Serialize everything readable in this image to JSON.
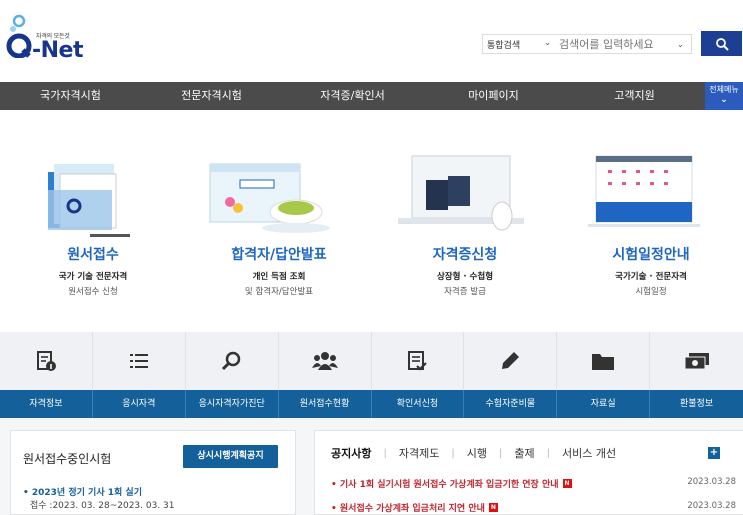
{
  "logo": {
    "small": "자격의 모든것",
    "main": "-Net"
  },
  "search": {
    "category": "통합검색",
    "placeholder": "검색어를 입력하세요"
  },
  "gnb": {
    "items": [
      "국가자격시험",
      "전문자격시험",
      "자격증/확인서",
      "마이페이지",
      "고객지원"
    ],
    "all_menu": "전체메뉴"
  },
  "quick": [
    {
      "title": "원서접수",
      "sub1": "국가 기술 전문자격",
      "sub2": "원서접수 신청"
    },
    {
      "title": "합격자/답안발표",
      "sub1": "개인 득점 조회",
      "sub2": "및 합격자/답안발표"
    },
    {
      "title": "자격증신청",
      "sub1": "상장형 · 수첩형",
      "sub2": "자격증 발급"
    },
    {
      "title": "시험일정안내",
      "sub1": "국가기술 · 전문자격",
      "sub2": "시험일정"
    }
  ],
  "iconbar": {
    "icons": [
      "info-doc-icon",
      "list-icon",
      "search-icon",
      "group-icon",
      "check-doc-icon",
      "pencil-icon",
      "folder-icon",
      "money-icon"
    ],
    "labels": [
      "자격정보",
      "응시자격",
      "응시자격자가진단",
      "원서접수현황",
      "확인서신청",
      "수험자준비물",
      "자료실",
      "환불정보"
    ]
  },
  "left_panel": {
    "title": "원서접수중인시험",
    "button": "상시시행계획공지",
    "item_title": "• 2023년 정기 기사 1회 실기",
    "item_date": "접수 :2023. 03. 28~2023. 03. 31"
  },
  "right_panel": {
    "tabs": [
      "공지사항",
      "자격제도",
      "시행",
      "출제",
      "서비스 개선"
    ],
    "plus": "+",
    "notices": [
      {
        "title": "• 기사 1회 실기시험 원서접수 가상계좌 입금기한 연장 안내",
        "date": "2023.03.28",
        "badge": "N"
      },
      {
        "title": "• 원서접수 가상계좌 입금처리 지연 안내",
        "date": "2023.03.28",
        "badge": "N"
      }
    ]
  },
  "colors": {
    "brand": "#17358a",
    "accent": "#1f66c2",
    "bar": "#14609a",
    "gnb": "#4b4b4b"
  }
}
